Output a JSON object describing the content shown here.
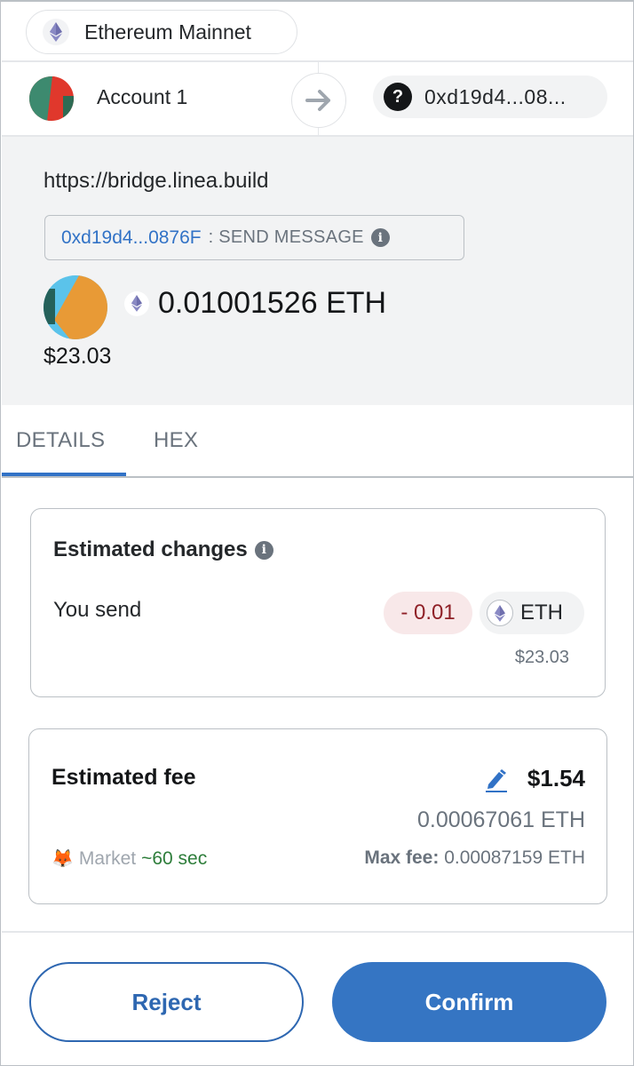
{
  "network": {
    "name": "Ethereum Mainnet",
    "icon": "ethereum-icon"
  },
  "accounts": {
    "from_name": "Account 1",
    "arrow_icon": "arrow-right-icon",
    "to_icon": "question-icon",
    "to_address": "0xd19d4...08..."
  },
  "summary": {
    "origin": "https://bridge.linea.build",
    "contract_address": "0xd19d4...0876F",
    "separator": ":",
    "method": "SEND MESSAGE",
    "info_icon": "i",
    "amount": "0.01001526 ETH",
    "fiat": "$23.03"
  },
  "tabs": [
    {
      "label": "DETAILS",
      "active": true
    },
    {
      "label": "HEX",
      "active": false
    }
  ],
  "estimated_changes": {
    "title": "Estimated changes",
    "info_icon": "i",
    "row_label": "You send",
    "amount": "- 0.01",
    "token": "ETH",
    "fiat": "$23.03"
  },
  "estimated_fee": {
    "title": "Estimated fee",
    "fiat": "$1.54",
    "eth": "0.00067061 ETH",
    "fox_icon": "🦊",
    "speed_label": "Market",
    "speed_time": "~60 sec",
    "max_fee_label": "Max fee:",
    "max_fee_value": "0.00087159 ETH"
  },
  "footer": {
    "reject_label": "Reject",
    "confirm_label": "Confirm"
  },
  "colors": {
    "primary": "#3575c3",
    "link": "#3172c6",
    "negative": "#8f2027",
    "negative_bg": "#f8e8e9",
    "success": "#2d7d3a",
    "muted": "#6a737d"
  }
}
